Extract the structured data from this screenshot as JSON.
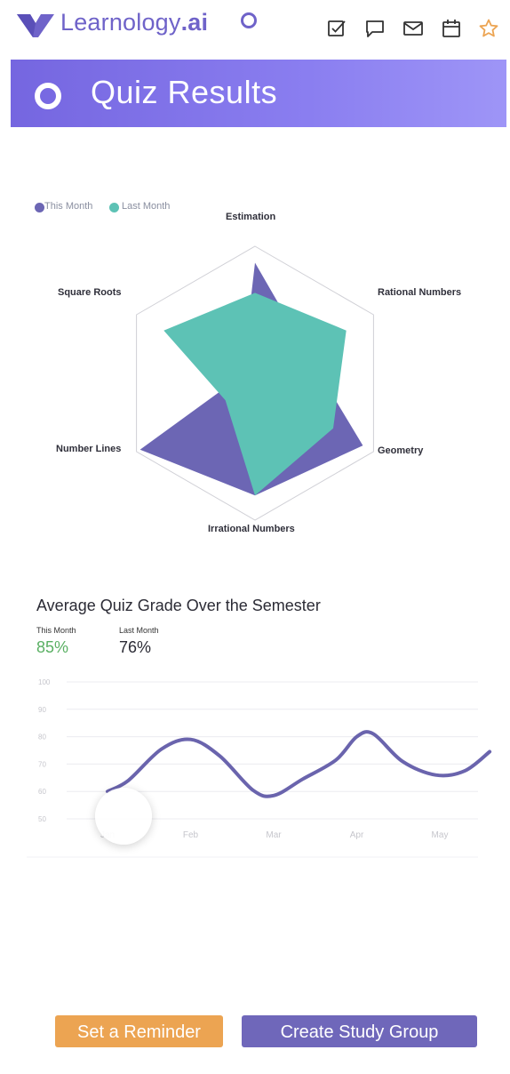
{
  "header": {
    "brand_main": "Learnology",
    "brand_suffix": ".ai",
    "icons": [
      "logo-icon",
      "status-ring-icon",
      "checkbox-icon",
      "chat-icon",
      "mail-icon",
      "calendar-icon",
      "star-icon"
    ]
  },
  "banner": {
    "title": "Quiz Results"
  },
  "radar": {
    "legend": [
      "This Month",
      "Last Month"
    ],
    "axes": [
      "Estimation",
      "Rational Numbers",
      "Geometry",
      "Irrational Numbers",
      "Number Lines",
      "Square Roots"
    ]
  },
  "line_section": {
    "title": "Average Quiz Grade Over the Semester",
    "this_month_label": "This Month",
    "this_month_value": "85%",
    "last_month_label": "Last Month",
    "last_month_value": "76%"
  },
  "chart_data": [
    {
      "type": "radar",
      "axes": [
        "Estimation",
        "Rational Numbers",
        "Geometry",
        "Irrational Numbers",
        "Number Lines",
        "Square Roots"
      ],
      "series": [
        {
          "name": "This Month",
          "values": [
            0.88,
            0.44,
            0.91,
            0.82,
            0.97,
            0.11
          ],
          "color": "#6c66b4"
        },
        {
          "name": "Last Month",
          "values": [
            0.66,
            0.77,
            0.66,
            0.82,
            0.25,
            0.77
          ],
          "color": "#5dc2b5"
        }
      ]
    },
    {
      "type": "line",
      "x": [
        "Jan",
        "Feb",
        "Mar",
        "Apr",
        "May"
      ],
      "yticks": [
        100,
        90,
        80,
        70,
        60,
        50
      ],
      "ylim": [
        46,
        100
      ],
      "points": [
        [
          0,
          60
        ],
        [
          0.25,
          64
        ],
        [
          0.65,
          75.5
        ],
        [
          1,
          79
        ],
        [
          1.35,
          73
        ],
        [
          1.75,
          60.5
        ],
        [
          2,
          58.5
        ],
        [
          2.35,
          64.5
        ],
        [
          2.75,
          71.5
        ],
        [
          3,
          80
        ],
        [
          3.2,
          81
        ],
        [
          3.55,
          71
        ],
        [
          3.95,
          66
        ],
        [
          4.3,
          67.5
        ],
        [
          4.6,
          74.5
        ]
      ],
      "color": "#6a64ad"
    }
  ],
  "buttons": {
    "reminder": "Set a Reminder",
    "study": "Create Study Group"
  }
}
